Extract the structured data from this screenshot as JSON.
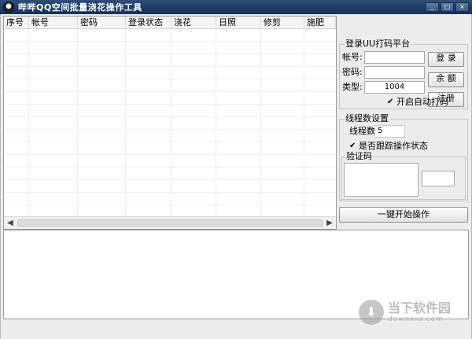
{
  "window": {
    "title": "哔哔QQ空间批量浇花操作工具",
    "buttons": [
      "_",
      "□",
      "×"
    ]
  },
  "table": {
    "columns": [
      "序号",
      "帐号",
      "密码",
      "登录状态",
      "浇花",
      "日照",
      "修剪",
      "施肥"
    ],
    "rows": []
  },
  "captcha_platform": {
    "title": "登录UU打码平台",
    "account_label": "帐号:",
    "account_value": "",
    "password_label": "密码:",
    "password_value": "",
    "type_label": "类型:",
    "type_value": "1004",
    "login_button": "登 录",
    "balance_button": "余 额",
    "register_button": "注册",
    "auto_captcha_label": "开启自动打码",
    "auto_captcha_checked": true
  },
  "thread_settings": {
    "title": "线程数设置",
    "thread_label": "线程数",
    "thread_value": "5",
    "track_label": "是否跟踪操作状态",
    "track_checked": true
  },
  "verify": {
    "title": "验证码",
    "input_value": ""
  },
  "start_button": "一键开始操作",
  "log_text": "",
  "watermark": {
    "title": "当下软件园",
    "url": "downxia.com"
  }
}
